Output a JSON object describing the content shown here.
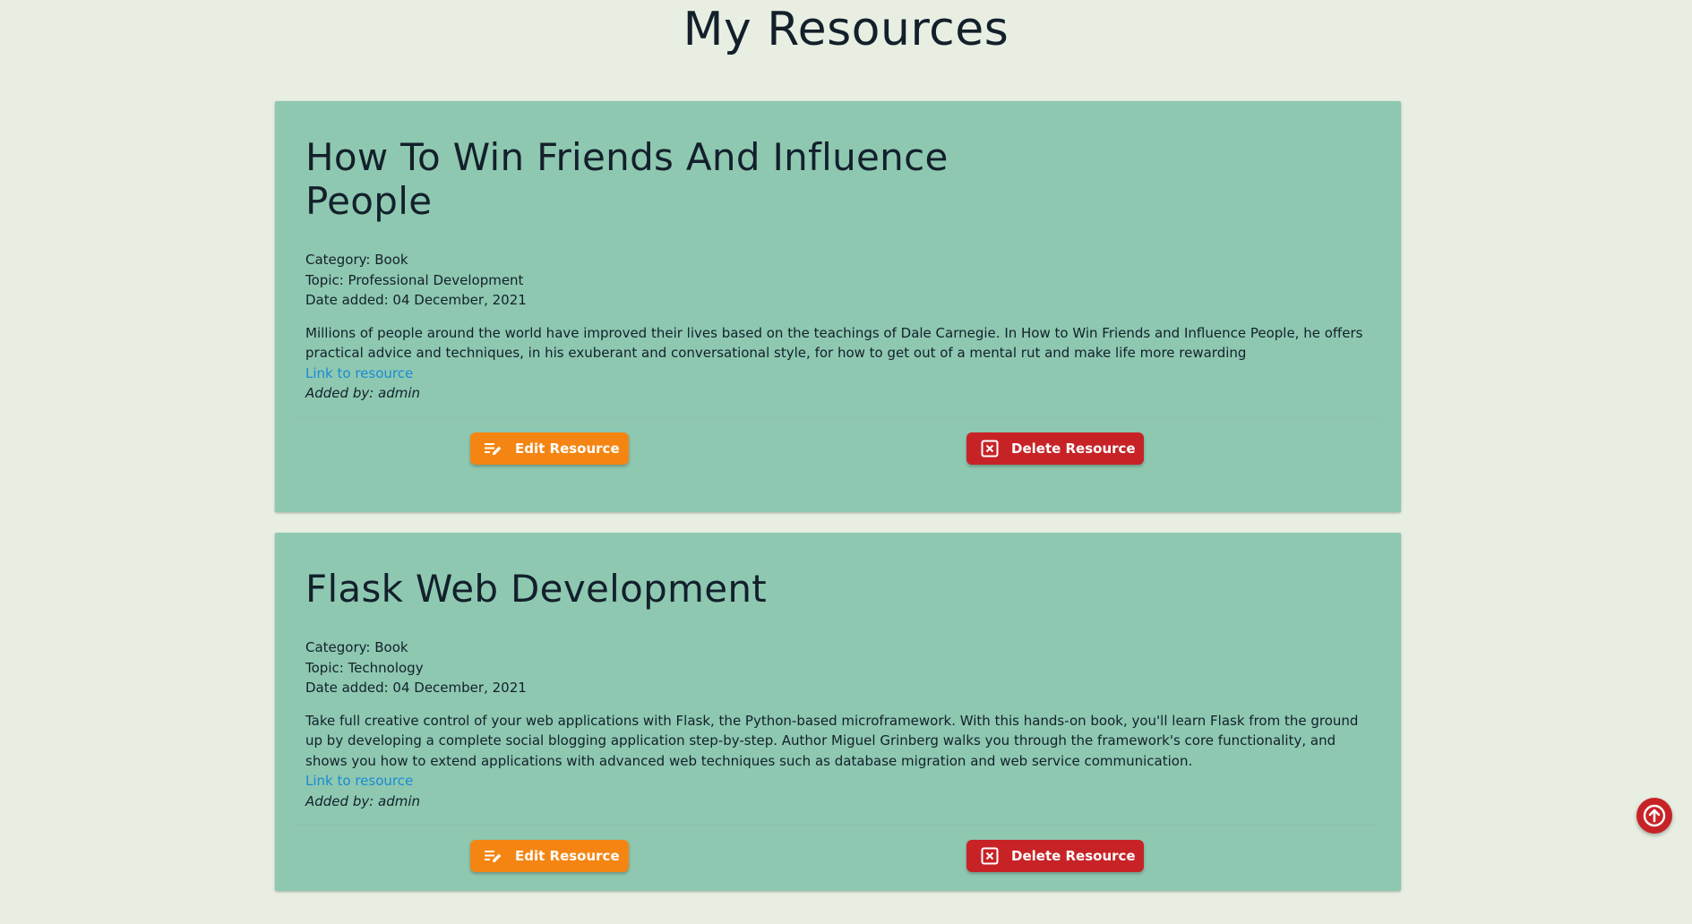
{
  "page": {
    "title": "My Resources"
  },
  "resources": [
    {
      "title": "How To Win Friends And Influence People",
      "category": "Category: Book",
      "topic": "Topic: Professional Development",
      "date_added": "Date added: 04 December, 2021",
      "description": "Millions of people around the world have improved their lives based on the teachings of Dale Carnegie. In How to Win Friends and Influence People, he offers practical advice and techniques, in his exuberant and conversational style, for how to get out of a mental rut and make life more rewarding",
      "link_label": "Link to resource",
      "added_by": "Added by: admin",
      "edit_label": "Edit Resource",
      "delete_label": "Delete Resource"
    },
    {
      "title": "Flask Web Development",
      "category": "Category: Book",
      "topic": "Topic: Technology",
      "date_added": "Date added: 04 December, 2021",
      "description": "Take full creative control of your web applications with Flask, the Python-based microframework. With this hands-on book, you'll learn Flask from the ground up by developing a complete social blogging application step-by-step. Author Miguel Grinberg walks you through the framework's core functionality, and shows you how to extend applications with advanced web techniques such as database migration and web service communication.",
      "link_label": "Link to resource",
      "added_by": "Added by: admin",
      "edit_label": "Edit Resource",
      "delete_label": "Delete Resource"
    }
  ],
  "icons": {
    "edit": "edit-note-icon",
    "delete": "close-box-icon",
    "back_to_top": "arrow-up-icon"
  },
  "colors": {
    "background": "#e8efe2",
    "card": "#8ec8b1",
    "edit_button": "#f58512",
    "delete_button": "#c72327",
    "link": "#1a8ad4"
  }
}
